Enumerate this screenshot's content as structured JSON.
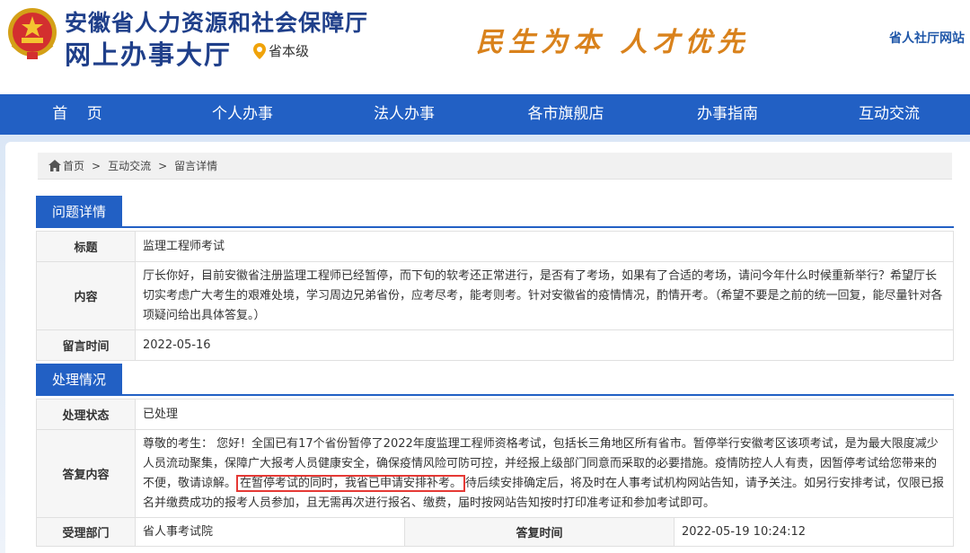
{
  "header": {
    "org_title": "安徽省人力资源和社会保障厅",
    "hall_title": "网上办事大厅",
    "level": "省本级",
    "slogan": "民生为本 人才优先",
    "top_link": "省人社厅网站"
  },
  "nav": [
    "首 页",
    "个人办事",
    "法人办事",
    "各市旗舰店",
    "办事指南",
    "互动交流"
  ],
  "breadcrumb": [
    "首页",
    "互动交流",
    "留言详情"
  ],
  "breadcrumb_sep": ">",
  "question": {
    "section_label": "问题详情",
    "title_label": "标题",
    "title": "监理工程师考试",
    "content_label": "内容",
    "content": "厅长你好，目前安徽省注册监理工程师已经暂停，而下旬的软考还正常进行，是否有了考场，如果有了合适的考场，请问今年什么时候重新举行？希望厅长切实考虑广大考生的艰难处境，学习周边兄弟省份，应考尽考，能考则考。针对安徽省的疫情情况，酌情开考。（希望不要是之前的统一回复，能尽量针对各项疑问给出具体答复。）",
    "time_label": "留言时间",
    "time": "2022-05-16"
  },
  "processing": {
    "section_label": "处理情况",
    "status_label": "处理状态",
    "status": "已处理",
    "reply_label": "答复内容",
    "reply_before": "尊敬的考生： 您好！全国已有17个省份暂停了2022年度监理工程师资格考试，包括长三角地区所有省市。暂停举行安徽考区该项考试，是为最大限度减少人员流动聚集，保障广大报考人员健康安全，确保疫情风险可防可控，并经报上级部门同意而采取的必要措施。疫情防控人人有责，因暂停考试给您带来的不便，敬请谅解。",
    "reply_highlight": "在暂停考试的同时，我省已申请安排补考。",
    "reply_after": "待后续安排确定后，将及时在人事考试机构网站告知，请予关注。如另行安排考试，仅限已报名并缴费成功的报考人员参加，且无需再次进行报名、缴费，届时按网站告知按时打印准考证和参加考试即可。",
    "dept_label": "受理部门",
    "dept": "省人事考试院",
    "reply_time_label": "答复时间",
    "reply_time": "2022-05-19 10:24:12"
  },
  "colors": {
    "primary": "#2260c4",
    "title_blue": "#1f3f8a",
    "slogan": "#d9821c",
    "highlight_border": "#e53935"
  }
}
